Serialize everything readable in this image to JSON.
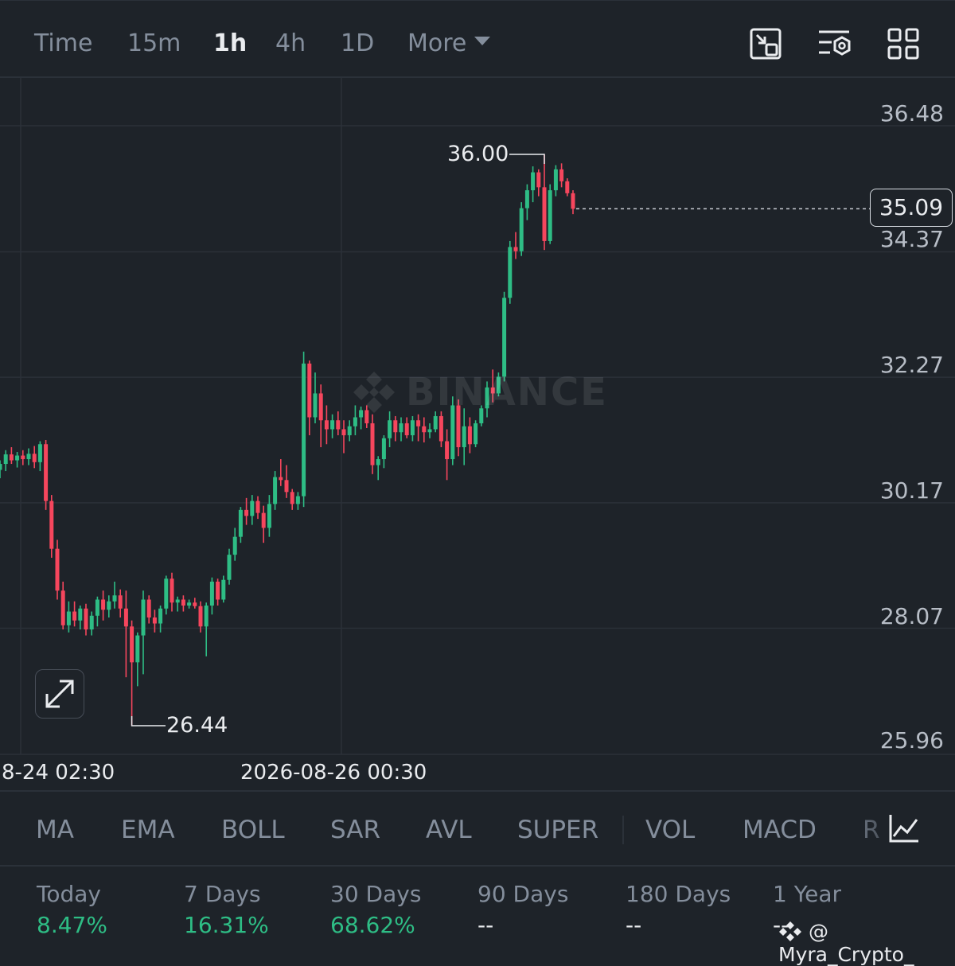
{
  "toolbar": {
    "intervals": [
      {
        "label": "Time",
        "active": false
      },
      {
        "label": "15m",
        "active": false
      },
      {
        "label": "1h",
        "active": true
      },
      {
        "label": "4h",
        "active": false
      },
      {
        "label": "1D",
        "active": false
      },
      {
        "label": "More",
        "active": false
      }
    ],
    "icons": [
      "screen-mode-icon",
      "chart-settings-icon",
      "layout-grid-icon"
    ]
  },
  "chart": {
    "watermark": "BINANCE",
    "price_axis": [
      "36.48",
      "34.37",
      "32.27",
      "30.17",
      "28.07",
      "25.96"
    ],
    "time_axis": [
      "8-24 02:30",
      "2026-08-26 00:30"
    ],
    "last_price": "35.09",
    "high_label": "36.00",
    "low_label": "26.44",
    "colors": {
      "up": "#2ebd85",
      "down": "#f6465d",
      "background": "#1e2329"
    }
  },
  "chart_data": {
    "type": "candlestick",
    "interval": "1h",
    "ylim": [
      25.96,
      36.48
    ],
    "y_ticks": [
      36.48,
      34.37,
      32.27,
      30.17,
      28.07,
      25.96
    ],
    "x_ticks": [
      "8-24 02:30",
      "2026-08-26 00:30"
    ],
    "last_price": 35.09,
    "max_high": 36.0,
    "min_low": 26.44,
    "candles": [
      [
        30.72,
        30.88,
        30.58,
        30.82
      ],
      [
        30.82,
        31.05,
        30.7,
        30.98
      ],
      [
        30.98,
        31.1,
        30.82,
        30.88
      ],
      [
        30.88,
        31.02,
        30.76,
        30.96
      ],
      [
        30.96,
        31.05,
        30.8,
        30.9
      ],
      [
        30.9,
        31.08,
        30.8,
        30.99
      ],
      [
        30.99,
        31.12,
        30.75,
        30.85
      ],
      [
        30.85,
        31.2,
        30.7,
        31.15
      ],
      [
        31.15,
        31.22,
        30.05,
        30.2
      ],
      [
        30.2,
        30.3,
        29.25,
        29.4
      ],
      [
        29.4,
        29.55,
        28.55,
        28.7
      ],
      [
        28.7,
        28.85,
        28.05,
        28.12
      ],
      [
        28.12,
        28.52,
        28.0,
        28.35
      ],
      [
        28.35,
        28.52,
        28.1,
        28.2
      ],
      [
        28.2,
        28.45,
        28.05,
        28.4
      ],
      [
        28.4,
        28.48,
        27.95,
        28.05
      ],
      [
        28.05,
        28.35,
        27.95,
        28.28
      ],
      [
        28.28,
        28.6,
        28.1,
        28.55
      ],
      [
        28.55,
        28.7,
        28.2,
        28.38
      ],
      [
        28.38,
        28.62,
        28.25,
        28.52
      ],
      [
        28.52,
        28.85,
        28.4,
        28.62
      ],
      [
        28.62,
        28.72,
        28.25,
        28.4
      ],
      [
        28.4,
        28.7,
        27.25,
        28.1
      ],
      [
        28.1,
        28.2,
        26.44,
        27.5
      ],
      [
        27.5,
        28.0,
        27.1,
        27.95
      ],
      [
        27.95,
        28.7,
        27.3,
        28.55
      ],
      [
        28.55,
        28.62,
        28.15,
        28.25
      ],
      [
        28.25,
        28.38,
        28.0,
        28.15
      ],
      [
        28.15,
        28.45,
        28.0,
        28.4
      ],
      [
        28.4,
        28.95,
        28.3,
        28.9
      ],
      [
        28.9,
        29.0,
        28.35,
        28.5
      ],
      [
        28.5,
        28.6,
        28.35,
        28.55
      ],
      [
        28.55,
        28.62,
        28.35,
        28.45
      ],
      [
        28.45,
        28.55,
        28.4,
        28.5
      ],
      [
        28.5,
        28.58,
        28.4,
        28.44
      ],
      [
        28.44,
        28.52,
        28.0,
        28.1
      ],
      [
        28.1,
        28.5,
        27.6,
        28.45
      ],
      [
        28.45,
        28.92,
        28.3,
        28.85
      ],
      [
        28.85,
        28.9,
        28.45,
        28.55
      ],
      [
        28.55,
        28.95,
        28.5,
        28.88
      ],
      [
        28.88,
        29.4,
        28.8,
        29.3
      ],
      [
        29.3,
        29.75,
        29.2,
        29.6
      ],
      [
        29.6,
        30.1,
        29.5,
        30.05
      ],
      [
        30.05,
        30.25,
        29.8,
        29.95
      ],
      [
        29.95,
        30.3,
        29.8,
        30.2
      ],
      [
        30.2,
        30.28,
        29.9,
        30.0
      ],
      [
        30.0,
        30.12,
        29.5,
        29.75
      ],
      [
        29.75,
        30.3,
        29.6,
        30.15
      ],
      [
        30.15,
        30.7,
        30.05,
        30.6
      ],
      [
        30.6,
        30.9,
        30.45,
        30.55
      ],
      [
        30.55,
        30.8,
        30.25,
        30.35
      ],
      [
        30.35,
        30.4,
        30.05,
        30.15
      ],
      [
        30.15,
        30.35,
        30.05,
        30.28
      ],
      [
        30.28,
        32.7,
        30.1,
        32.5
      ],
      [
        32.5,
        32.55,
        31.3,
        31.6
      ],
      [
        31.6,
        32.35,
        31.5,
        32.0
      ],
      [
        32.0,
        32.15,
        31.1,
        31.55
      ],
      [
        31.55,
        31.8,
        31.15,
        31.4
      ],
      [
        31.4,
        31.65,
        31.25,
        31.55
      ],
      [
        31.55,
        31.7,
        31.3,
        31.4
      ],
      [
        31.4,
        31.55,
        31.0,
        31.3
      ],
      [
        31.3,
        31.55,
        31.2,
        31.45
      ],
      [
        31.45,
        31.8,
        31.3,
        31.6
      ],
      [
        31.6,
        31.78,
        31.4,
        31.72
      ],
      [
        31.72,
        31.8,
        31.42,
        31.5
      ],
      [
        31.5,
        31.65,
        30.65,
        30.8
      ],
      [
        30.8,
        30.95,
        30.55,
        30.9
      ],
      [
        30.9,
        31.3,
        30.75,
        31.25
      ],
      [
        31.25,
        31.7,
        31.1,
        31.55
      ],
      [
        31.55,
        31.62,
        31.2,
        31.35
      ],
      [
        31.35,
        31.6,
        31.2,
        31.5
      ],
      [
        31.5,
        31.6,
        31.25,
        31.3
      ],
      [
        31.3,
        31.62,
        31.2,
        31.55
      ],
      [
        31.55,
        31.65,
        31.2,
        31.45
      ],
      [
        31.45,
        31.6,
        31.18,
        31.35
      ],
      [
        31.35,
        31.5,
        31.25,
        31.4
      ],
      [
        31.4,
        31.7,
        31.35,
        31.62
      ],
      [
        31.62,
        31.7,
        31.1,
        31.2
      ],
      [
        31.2,
        31.4,
        30.55,
        30.9
      ],
      [
        30.9,
        31.95,
        30.8,
        31.8
      ],
      [
        31.8,
        31.9,
        30.95,
        31.1
      ],
      [
        31.1,
        31.75,
        30.8,
        31.45
      ],
      [
        31.45,
        31.6,
        31.0,
        31.15
      ],
      [
        31.15,
        31.55,
        31.1,
        31.5
      ],
      [
        31.5,
        31.8,
        31.45,
        31.75
      ],
      [
        31.75,
        32.2,
        31.6,
        32.1
      ],
      [
        32.1,
        32.4,
        31.85,
        32.0
      ],
      [
        32.0,
        32.35,
        31.95,
        32.28
      ],
      [
        32.28,
        33.7,
        32.2,
        33.6
      ],
      [
        33.6,
        34.55,
        33.5,
        34.45
      ],
      [
        34.45,
        34.7,
        34.25,
        34.38
      ],
      [
        34.38,
        35.2,
        34.3,
        35.1
      ],
      [
        35.1,
        35.5,
        34.9,
        35.4
      ],
      [
        35.4,
        35.8,
        35.2,
        35.7
      ],
      [
        35.7,
        35.75,
        35.3,
        35.45
      ],
      [
        35.45,
        36.0,
        34.4,
        34.55
      ],
      [
        34.55,
        35.5,
        34.5,
        35.4
      ],
      [
        35.4,
        35.82,
        35.3,
        35.75
      ],
      [
        35.75,
        35.85,
        35.45,
        35.55
      ],
      [
        35.55,
        35.6,
        35.3,
        35.35
      ],
      [
        35.35,
        35.4,
        35.0,
        35.09
      ]
    ]
  },
  "indicators": [
    "MA",
    "EMA",
    "BOLL",
    "SAR",
    "AVL",
    "SUPER",
    "VOL",
    "MACD",
    "R"
  ],
  "performance": [
    {
      "label": "Today",
      "value": "8.47%",
      "positive": true
    },
    {
      "label": "7 Days",
      "value": "16.31%",
      "positive": true
    },
    {
      "label": "30 Days",
      "value": "68.62%",
      "positive": true
    },
    {
      "label": "90 Days",
      "value": "--",
      "positive": false
    },
    {
      "label": "180 Days",
      "value": "--",
      "positive": false
    },
    {
      "label": "1 Year",
      "value": "--",
      "positive": false
    }
  ],
  "credit": "@ Myra_Crypto_"
}
